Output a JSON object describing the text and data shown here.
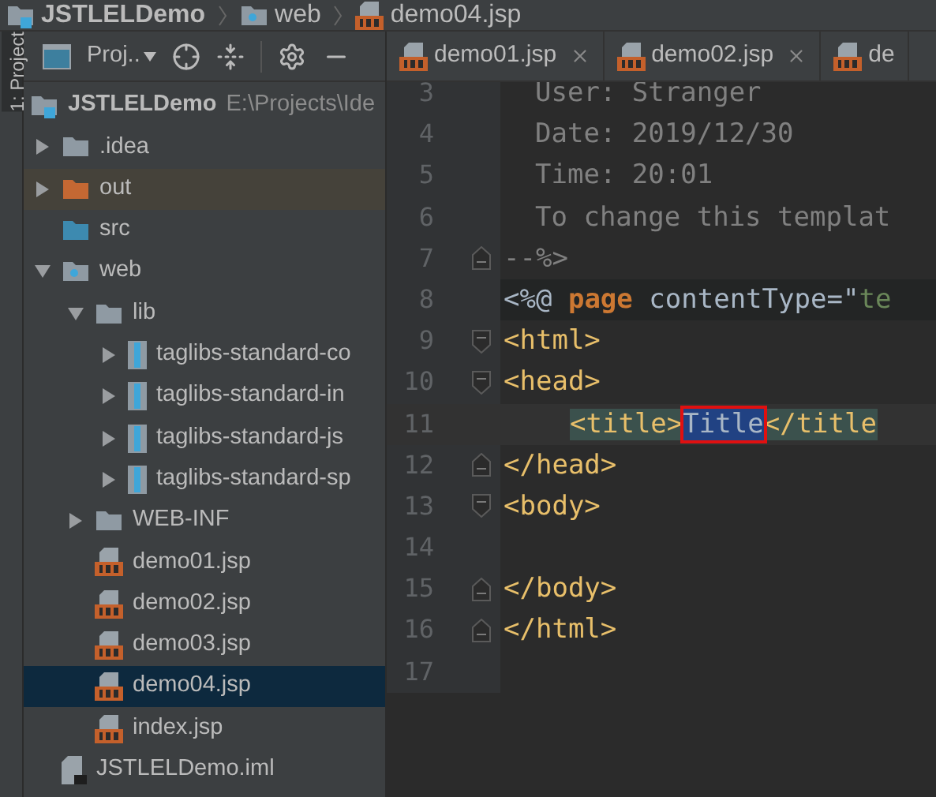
{
  "breadcrumbs": [
    {
      "label": "JSTLELDemo",
      "kind": "module"
    },
    {
      "label": "web",
      "kind": "web"
    },
    {
      "label": "demo04.jsp",
      "kind": "jsp"
    }
  ],
  "tool_strip": {
    "label": "1: Project"
  },
  "project_panel": {
    "view": "Proj..",
    "tree": [
      {
        "label": "JSTLELDemo",
        "path": "E:\\Projects\\Ide",
        "kind": "module",
        "selected": false,
        "children": [
          {
            "label": ".idea",
            "kind": "folder",
            "expanded": false,
            "selected": false
          },
          {
            "label": "out",
            "kind": "excluded",
            "expanded": false,
            "selected": false
          },
          {
            "label": "src",
            "kind": "source",
            "selected": false
          },
          {
            "label": "web",
            "kind": "web",
            "expanded": true,
            "selected": false,
            "children": [
              {
                "label": "lib",
                "kind": "folder",
                "expanded": true,
                "selected": false,
                "children": [
                  {
                    "label": "taglibs-standard-co",
                    "kind": "library",
                    "expanded": false,
                    "selected": false
                  },
                  {
                    "label": "taglibs-standard-in",
                    "kind": "library",
                    "expanded": false,
                    "selected": false
                  },
                  {
                    "label": "taglibs-standard-js",
                    "kind": "library",
                    "expanded": false,
                    "selected": false
                  },
                  {
                    "label": "taglibs-standard-sp",
                    "kind": "library",
                    "expanded": false,
                    "selected": false
                  }
                ]
              },
              {
                "label": "WEB-INF",
                "kind": "folder",
                "expanded": false,
                "selected": false
              },
              {
                "label": "demo01.jsp",
                "kind": "jsp",
                "selected": false
              },
              {
                "label": "demo02.jsp",
                "kind": "jsp",
                "selected": false
              },
              {
                "label": "demo03.jsp",
                "kind": "jsp",
                "selected": false
              },
              {
                "label": "demo04.jsp",
                "kind": "jsp",
                "selected": true
              },
              {
                "label": "index.jsp",
                "kind": "jsp",
                "selected": false
              }
            ]
          },
          {
            "label": "JSTLELDemo.iml",
            "kind": "iml",
            "selected": false
          }
        ]
      }
    ]
  },
  "tabs": [
    {
      "label": "demo01.jsp",
      "selected": false
    },
    {
      "label": "demo02.jsp",
      "selected": false
    },
    {
      "label": "de",
      "selected": false
    }
  ],
  "editor": {
    "lines": [
      {
        "number": "3",
        "kind": "comment",
        "fold_start": false,
        "fold_end": false,
        "tokens": [
          {
            "text": "User: Stranger",
            "kind": "comment"
          }
        ]
      },
      {
        "number": "4",
        "kind": "comment",
        "fold_start": false,
        "fold_end": false,
        "tokens": [
          {
            "text": "Date: 2019/12/30",
            "kind": "comment"
          }
        ]
      },
      {
        "number": "5",
        "kind": "comment",
        "fold_start": false,
        "fold_end": false,
        "tokens": [
          {
            "text": "Time: 20:01",
            "kind": "comment"
          }
        ]
      },
      {
        "number": "6",
        "kind": "comment",
        "fold_start": false,
        "fold_end": false,
        "tokens": [
          {
            "text": "To change this templat",
            "kind": "comment"
          }
        ]
      },
      {
        "number": "7",
        "kind": "plain",
        "fold_start": false,
        "fold_end": true,
        "tokens": [
          {
            "text": "--%>",
            "kind": "comment"
          }
        ]
      },
      {
        "number": "8",
        "kind": "injected",
        "fold_start": false,
        "fold_end": false,
        "tokens": [
          {
            "text": "<%@",
            "kind": "text"
          },
          {
            "text": " page",
            "kind": "keyword"
          },
          {
            "text": " contentType=\"",
            "kind": "text"
          },
          {
            "text": "te",
            "kind": "string"
          }
        ]
      },
      {
        "number": "9",
        "kind": "plain",
        "fold_start": true,
        "fold_end": false,
        "tokens": [
          {
            "text": "<html>",
            "kind": "tag"
          }
        ]
      },
      {
        "number": "10",
        "kind": "plain",
        "fold_start": true,
        "fold_end": false,
        "tokens": [
          {
            "text": "<head>",
            "kind": "tag"
          }
        ]
      },
      {
        "number": "11",
        "kind": "current",
        "fold_start": false,
        "fold_end": false,
        "tokens": [
          {
            "text": "<title>",
            "kind": "tag",
            "matched": true,
            "selected": false
          },
          {
            "text": "Title",
            "kind": "text",
            "matched": true,
            "selected": true
          },
          {
            "text": "</title",
            "kind": "tag",
            "matched": true,
            "selected": false
          }
        ]
      },
      {
        "number": "12",
        "kind": "plain",
        "fold_start": false,
        "fold_end": true,
        "tokens": [
          {
            "text": "</head>",
            "kind": "tag"
          }
        ]
      },
      {
        "number": "13",
        "kind": "plain",
        "fold_start": true,
        "fold_end": false,
        "tokens": [
          {
            "text": "<body>",
            "kind": "tag"
          }
        ]
      },
      {
        "number": "14",
        "kind": "plain",
        "fold_start": false,
        "fold_end": false
      },
      {
        "number": "15",
        "kind": "plain",
        "fold_start": false,
        "fold_end": true,
        "tokens": [
          {
            "text": "</body>",
            "kind": "tag"
          }
        ]
      },
      {
        "number": "16",
        "kind": "plain",
        "fold_start": false,
        "fold_end": true,
        "tokens": [
          {
            "text": "</html>",
            "kind": "tag"
          }
        ]
      },
      {
        "number": "17",
        "kind": "plain",
        "fold_start": false,
        "fold_end": false
      }
    ]
  }
}
